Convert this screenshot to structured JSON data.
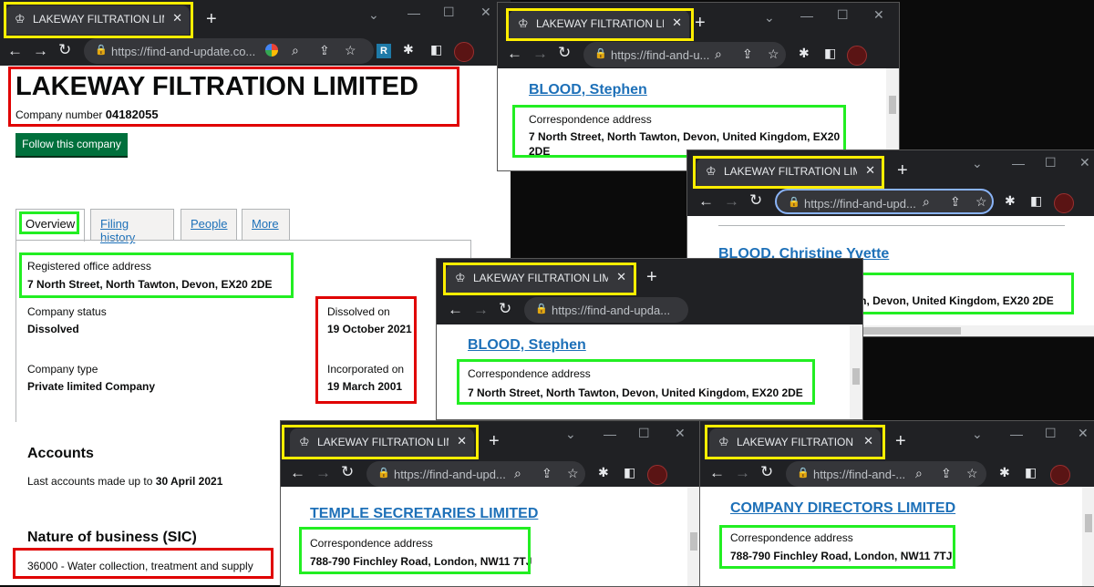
{
  "tab_title": "LAKEWAY FILTRATION LIMITED",
  "main": {
    "tab_title": "LAKEWAY FILTRATION LIMITED",
    "url": "https://find-and-update.co...",
    "company_name": "LAKEWAY FILTRATION LIMITED",
    "company_number_label": "Company number",
    "company_number": "04182055",
    "follow_button": "Follow this company",
    "tabs": [
      "Overview",
      "Filing history",
      "People",
      "More"
    ],
    "registered_office_label": "Registered office address",
    "registered_office": "7 North Street, North Tawton, Devon, EX20 2DE",
    "status_label": "Company status",
    "status": "Dissolved",
    "dissolved_label": "Dissolved on",
    "dissolved_date": "19 October 2021",
    "type_label": "Company type",
    "type": "Private limited Company",
    "incorporated_label": "Incorporated on",
    "incorporated_date": "19 March 2001",
    "accounts_heading": "Accounts",
    "accounts_text": "Last accounts made up to",
    "accounts_date": "30 April 2021",
    "sic_heading": "Nature of business (SIC)",
    "sic": "36000 - Water collection, treatment and supply"
  },
  "officers": {
    "corr_label": "Correspondence address",
    "w1": {
      "url": "https://find-and-u...",
      "name": "BLOOD, Stephen",
      "address_line1": "7 North Street, North Tawton, Devon, United Kingdom, EX20",
      "address_line2": "2DE"
    },
    "w2": {
      "url": "https://find-and-upd...",
      "name": "BLOOD, Christine Yvette",
      "address": "7 North Street, North Tawton, Devon, United Kingdom, EX20 2DE"
    },
    "w3": {
      "url": "https://find-and-upda...",
      "name": "BLOOD, Stephen",
      "address": "7 North Street, North Tawton, Devon, United Kingdom, EX20 2DE"
    },
    "w4": {
      "url": "https://find-and-upd...",
      "name": "TEMPLE SECRETARIES LIMITED",
      "address": "788-790 Finchley Road, London, NW11 7TJ"
    },
    "w5": {
      "url": "https://find-and-...",
      "name": "COMPANY DIRECTORS LIMITED",
      "address": "788-790 Finchley Road, London, NW11 7TJ"
    }
  },
  "colors": {
    "highlight_yellow": "#ffee00",
    "highlight_green": "#22ee22",
    "highlight_red": "#e00000",
    "link": "#1d70b8",
    "follow_button": "#00703c",
    "chrome_dark": "#202124"
  },
  "icons": [
    "crown-icon",
    "close-icon",
    "new-tab-icon",
    "back-icon",
    "forward-icon",
    "reload-icon",
    "lock-icon",
    "google-icon",
    "zoom-icon",
    "share-icon",
    "bookmark-star-icon",
    "extensions-icon",
    "sidepanel-icon",
    "profile-avatar"
  ]
}
